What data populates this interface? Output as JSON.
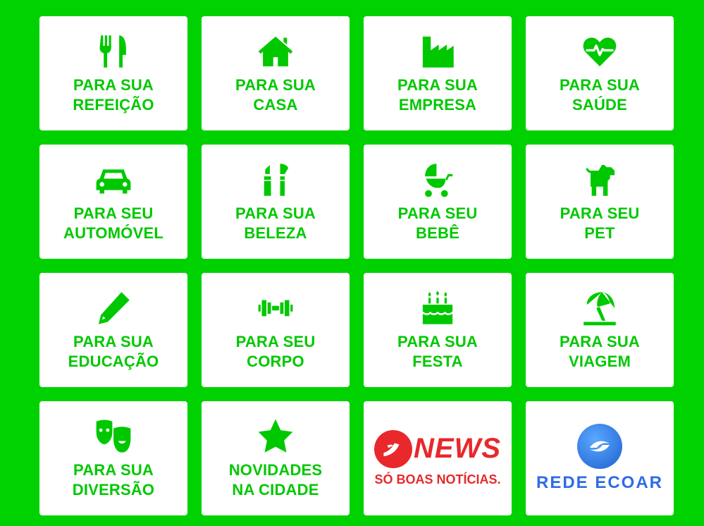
{
  "tiles": [
    {
      "icon": "utensils-icon",
      "line1": "PARA SUA",
      "line2": "REFEIÇÃO"
    },
    {
      "icon": "home-icon",
      "line1": "PARA SUA",
      "line2": "CASA"
    },
    {
      "icon": "industry-icon",
      "line1": "PARA SUA",
      "line2": "EMPRESA"
    },
    {
      "icon": "heartbeat-icon",
      "line1": "PARA SUA",
      "line2": "SAÚDE"
    },
    {
      "icon": "car-icon",
      "line1": "PARA SEU",
      "line2": "AUTOMÓVEL"
    },
    {
      "icon": "makeup-icon",
      "line1": "PARA SUA",
      "line2": "BELEZA"
    },
    {
      "icon": "baby-carriage-icon",
      "line1": "PARA SEU",
      "line2": "BEBÊ"
    },
    {
      "icon": "dog-icon",
      "line1": "PARA SEU",
      "line2": "PET"
    },
    {
      "icon": "pencil-icon",
      "line1": "PARA SUA",
      "line2": "EDUCAÇÃO"
    },
    {
      "icon": "dumbbell-icon",
      "line1": "PARA SEU",
      "line2": "CORPO"
    },
    {
      "icon": "birthday-cake-icon",
      "line1": "PARA SUA",
      "line2": "FESTA"
    },
    {
      "icon": "umbrella-beach-icon",
      "line1": "PARA SUA",
      "line2": "VIAGEM"
    },
    {
      "icon": "theater-masks-icon",
      "line1": "PARA SUA",
      "line2": "DIVERSÃO"
    },
    {
      "icon": "star-icon",
      "line1": "NOVIDADES",
      "line2": "NA CIDADE"
    }
  ],
  "news_logo": {
    "brand": "NEWS",
    "tagline": "SÓ BOAS NOTÍCIAS."
  },
  "ecoar_logo": {
    "brand": "REDE ECOAR"
  },
  "colors": {
    "background": "#00d100",
    "accent": "#00c800",
    "news_red": "#e8282b",
    "ecoar_blue": "#2f6ce8"
  }
}
